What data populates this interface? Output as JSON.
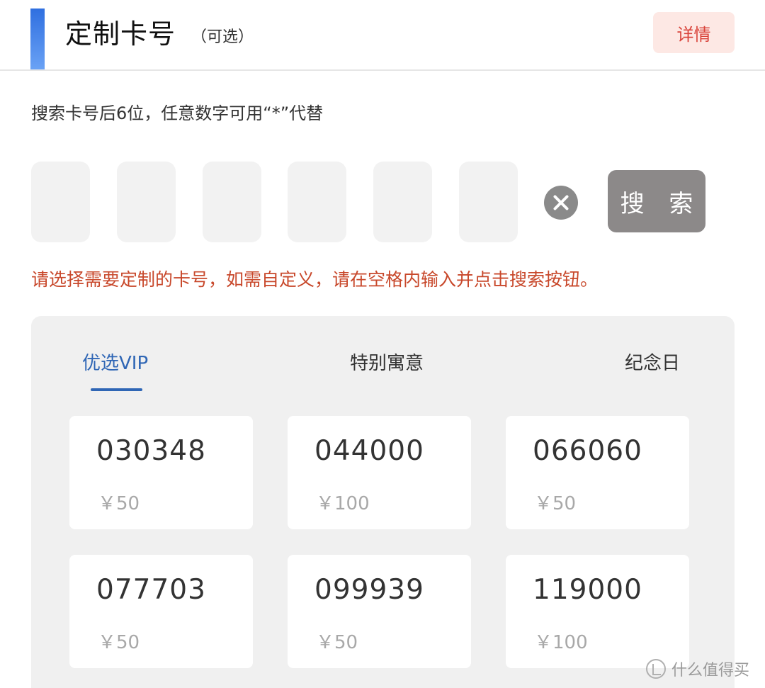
{
  "header": {
    "title": "定制卡号",
    "subtitle": "（可选）",
    "detail_label": "详情"
  },
  "search": {
    "hint": "搜索卡号后6位，任意数字可用“*”代替",
    "digits": [
      "",
      "",
      "",
      "",
      "",
      ""
    ],
    "clear_icon": "close-circle-icon",
    "search_label": "搜 索",
    "note": "请选择需要定制的卡号，如需自定义，请在空格内输入并点击搜索按钮。"
  },
  "tabs": [
    {
      "label": "优选VIP",
      "active": true
    },
    {
      "label": "特别寓意",
      "active": false
    },
    {
      "label": "纪念日",
      "active": false
    }
  ],
  "cards": [
    {
      "number": "030348",
      "price": "￥50"
    },
    {
      "number": "044000",
      "price": "￥100"
    },
    {
      "number": "066060",
      "price": "￥50"
    },
    {
      "number": "077703",
      "price": "￥50"
    },
    {
      "number": "099939",
      "price": "￥50"
    },
    {
      "number": "119000",
      "price": "￥100"
    }
  ],
  "watermark": {
    "text": "什么值得买"
  },
  "colors": {
    "accent": "#2f6fe0",
    "active_tab": "#2f66b5",
    "note": "#c8482b",
    "detail_bg": "#fde8e4",
    "detail_text": "#d9433a",
    "search_bg": "#8c8989"
  }
}
